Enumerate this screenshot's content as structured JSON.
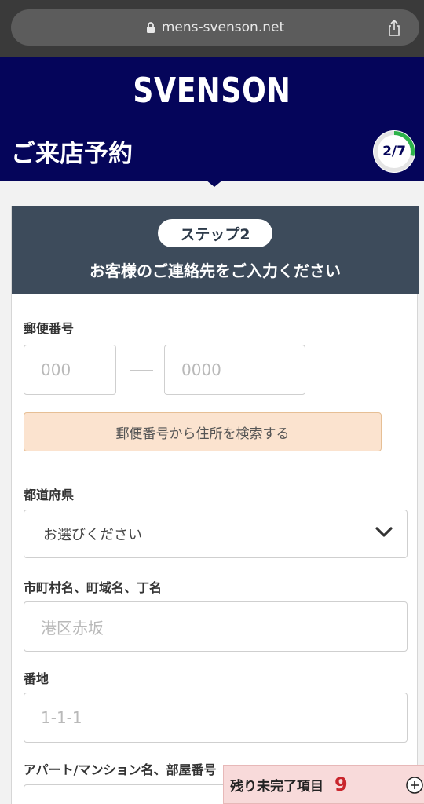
{
  "browser": {
    "url": "mens-svenson.net"
  },
  "header": {
    "logo": "SVENSON",
    "title": "ご来店予約",
    "progress_text": "2/7",
    "progress_fraction": 0.2857
  },
  "step": {
    "badge": "ステップ2",
    "heading": "お客様のご連絡先をご入力ください"
  },
  "form": {
    "postal": {
      "label": "郵便番号",
      "placeholder1": "000",
      "placeholder2": "0000",
      "search_button": "郵便番号から住所を検索する"
    },
    "prefecture": {
      "label": "都道府県",
      "selected": "お選びください"
    },
    "city": {
      "label": "市町村名、町域名、丁名",
      "placeholder": "港区赤坂"
    },
    "block": {
      "label": "番地",
      "placeholder": "1-1-1"
    },
    "apartment": {
      "label": "アパート/マンション名、部屋番号"
    }
  },
  "remaining": {
    "label": "残り未完了項目",
    "count": "9"
  },
  "colors": {
    "header_bg": "#05055a",
    "step_bg": "#3d4b5b",
    "progress_green": "#2db34a",
    "search_btn_bg": "#fbe3cf",
    "remaining_bg": "#f8dada",
    "remaining_count": "#c9252c"
  }
}
